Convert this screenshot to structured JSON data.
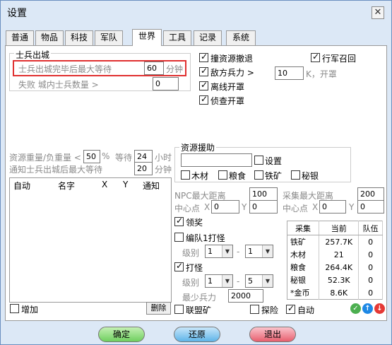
{
  "window": {
    "title": "设置",
    "close_glyph": "✕"
  },
  "tabs": [
    "普通",
    "物品",
    "科技",
    "军队",
    "世界",
    "工具",
    "记录",
    "系统"
  ],
  "active_tab": "世界",
  "soldier_group": {
    "title": "士兵出城",
    "wait_label": "士兵出城完毕后最大等待",
    "wait_value": "60",
    "wait_unit": "分钟",
    "fail_label": "失败 城内士兵数量 >",
    "fail_value": "0"
  },
  "right_opts": {
    "retreat_label": "撞资源撤退",
    "retreat_checked": true,
    "enemy_label": "敌方兵力 >",
    "enemy_checked": true,
    "enemy_value": "10",
    "enemy_suffix": "K，开罩",
    "offline_label": "离线开罩",
    "offline_checked": true,
    "scout_label": "侦查开罩",
    "scout_checked": true,
    "recall_label": "行军召回",
    "recall_checked": true
  },
  "load": {
    "ratio_label": "资源重量/负重量 <",
    "ratio_value": "50",
    "ratio_unit": "%",
    "wait1_label": "等待",
    "wait1_value": "24",
    "wait1_unit": "小时",
    "notify_label": "通知士兵出城后最大等待",
    "wait2_value": "20",
    "wait2_unit": "分钟"
  },
  "list": {
    "headers": [
      "自动",
      "名字",
      "X",
      "Y",
      "通知"
    ],
    "add_label": "增加",
    "delete_label": "删除"
  },
  "aid": {
    "title": "资源援助",
    "input_value": "",
    "setting_label": "设置",
    "wood_label": "木材",
    "food_label": "粮食",
    "iron_label": "铁矿",
    "silver_label": "秘银"
  },
  "npc": {
    "dist_label": "NPC最大距离",
    "dist_value": "100",
    "center_label": "中心点",
    "x_label": "X",
    "x_value": "0",
    "y_label": "Y",
    "y_value": "0"
  },
  "gather": {
    "dist_label": "采集最大距离",
    "dist_value": "200",
    "center_label": "中心点",
    "x_label": "X",
    "x_value": "0",
    "y_label": "Y",
    "y_value": "0"
  },
  "reward": {
    "label": "领奖",
    "checked": true
  },
  "squad": {
    "label": "编队1打怪",
    "checked": false,
    "level_label": "级别",
    "from": "1",
    "to": "1",
    "dash": "-"
  },
  "monster": {
    "label": "打怪",
    "checked": true,
    "level_label": "级别",
    "from": "1",
    "to": "5",
    "dash": "-",
    "min_label": "最少兵力",
    "min_value": "2000"
  },
  "resources": {
    "headers": [
      "采集",
      "当前",
      "队伍"
    ],
    "rows": [
      [
        "铁矿",
        "257.7K",
        "0"
      ],
      [
        "木材",
        "21",
        "0"
      ],
      [
        "粮食",
        "264.4K",
        "0"
      ],
      [
        "秘银",
        "52.3K",
        "0"
      ],
      [
        "*金币",
        "8.6K",
        "0"
      ]
    ]
  },
  "bottom_checks": {
    "alliance_label": "联盟矿",
    "alliance_checked": false,
    "explore_label": "探险",
    "explore_checked": false,
    "auto_label": "自动",
    "auto_checked": true
  },
  "buttons": {
    "ok": "确定",
    "restore": "还原",
    "exit": "退出"
  },
  "colors": {
    "ok": "#6fcf5f",
    "restore": "#5fb4e8",
    "exit": "#e85f6f",
    "highlight": "#e03030"
  }
}
